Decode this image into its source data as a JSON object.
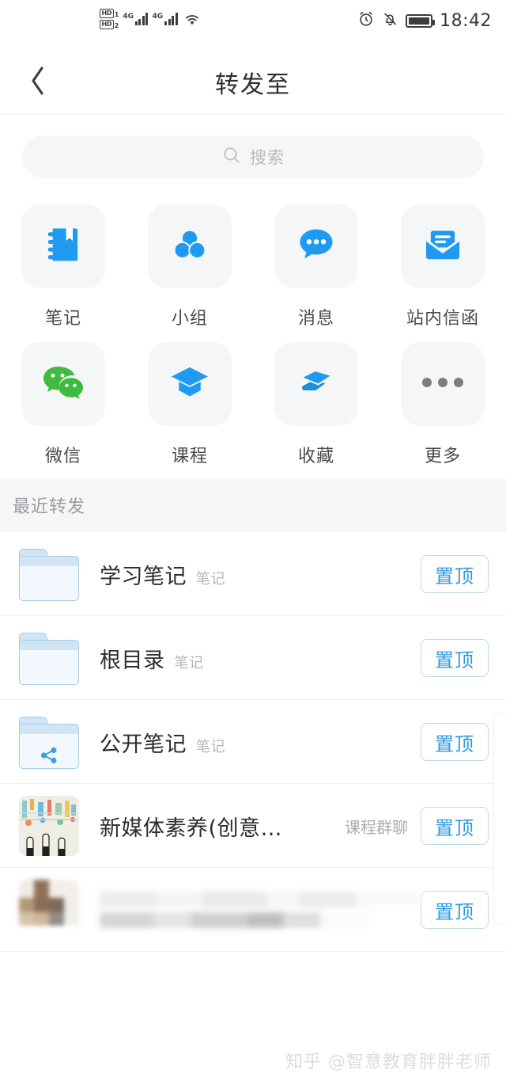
{
  "status_bar": {
    "hd1_label": "HD",
    "hd1_num": "1",
    "hd2_label": "HD",
    "hd2_num": "2",
    "sim1_network": "4G",
    "sim2_network": "4G",
    "wifi_icon": "wifi-icon",
    "alarm_icon": "alarm-clock-icon",
    "mute_icon": "bell-muted-icon",
    "battery_icon": "battery-full-icon",
    "time": "18:42"
  },
  "nav": {
    "back_icon": "chevron-left-icon",
    "title": "转发至"
  },
  "search": {
    "icon": "search-icon",
    "placeholder": "搜索",
    "value": ""
  },
  "shortcuts": [
    {
      "label": "笔记",
      "icon": "notebook-icon",
      "color": "#1e9bf0"
    },
    {
      "label": "小组",
      "icon": "group-circles-icon",
      "color": "#1e9bf0"
    },
    {
      "label": "消息",
      "icon": "chat-bubble-icon",
      "color": "#1e9bf0"
    },
    {
      "label": "站内信函",
      "icon": "envelope-icon",
      "color": "#1e9bf0"
    },
    {
      "label": "微信",
      "icon": "wechat-icon",
      "color": "#3fbb3f"
    },
    {
      "label": "课程",
      "icon": "graduation-cap-icon",
      "color": "#1e9bf0"
    },
    {
      "label": "收藏",
      "icon": "layers-icon",
      "color": "#1e9bf0"
    },
    {
      "label": "更多",
      "icon": "ellipsis-icon",
      "color": "#8a8a8a"
    }
  ],
  "recent": {
    "section_title": "最近转发",
    "pin_label": "置顶",
    "items": [
      {
        "title": "学习笔记",
        "tag": "笔记",
        "meta": "",
        "icon": "folder-icon"
      },
      {
        "title": "根目录",
        "tag": "笔记",
        "meta": "",
        "icon": "folder-icon"
      },
      {
        "title": "公开笔记",
        "tag": "笔记",
        "meta": "",
        "icon": "folder-shared-icon"
      },
      {
        "title": "新媒体素养(创意…",
        "tag": "",
        "meta": "课程群聊",
        "icon": "course-thumbnail"
      },
      {
        "title": "",
        "tag": "",
        "meta": "",
        "icon": "blurred-thumbnail"
      }
    ]
  },
  "watermark": {
    "text": "知乎 @智意教育胖胖老师"
  },
  "theme": {
    "accent_blue": "#1e9bf0",
    "wechat_green": "#3fbb3f",
    "tile_bg": "#f5f6f7",
    "pin_border": "#bcd9e6",
    "pin_text": "#2f9ae0"
  }
}
